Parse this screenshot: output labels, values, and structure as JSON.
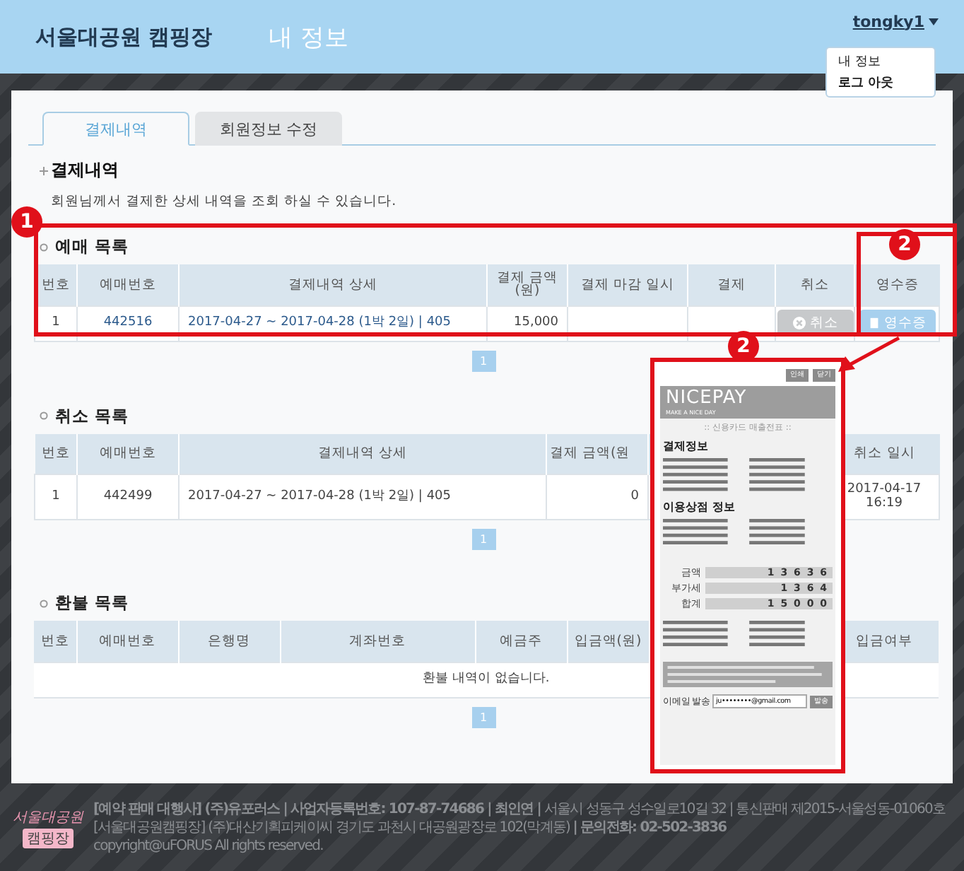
{
  "header": {
    "site_title": "서울대공원 캠핑장",
    "page_title": "내 정보",
    "user": "tongky1",
    "user_menu": [
      {
        "label": "내 정보",
        "selected": false
      },
      {
        "label": "로그 아웃",
        "selected": true
      }
    ]
  },
  "tabs": [
    {
      "label": "결제내역",
      "selected": true
    },
    {
      "label": "회원정보 수정",
      "selected": false
    }
  ],
  "section": {
    "title": "결제내역",
    "description": "회원님께서 결제한 상세 내역을 조회 하실 수 있습니다."
  },
  "bookings": {
    "title": "예매 목록",
    "columns": [
      "번호",
      "예매번호",
      "결제내역 상세",
      "결제 금액\n(원)",
      "결제 마감 일시",
      "결제",
      "취소",
      "영수증"
    ],
    "rows": [
      {
        "no": "1",
        "booking_no": "442516",
        "detail": "2017-04-27 ~ 2017-04-28 (1박 2일) | 405",
        "amount": "15,000",
        "deadline": "",
        "payment": "",
        "cancel_button": {
          "label": "취소",
          "disabled": true
        },
        "receipt_button": {
          "label": "영수증",
          "disabled": false
        }
      }
    ],
    "pagination": [
      {
        "label": "1",
        "selected": true
      }
    ]
  },
  "cancellations": {
    "title": "취소 목록",
    "columns": [
      "번호",
      "예매번호",
      "결제내역 상세",
      "결제 금액(원",
      "취소 일시"
    ],
    "rows": [
      {
        "cells": [
          "1",
          "442499",
          "2017-04-27 ~ 2017-04-28 (1박 2일) | 405",
          "0",
          "2017-04-17\n16:19"
        ]
      }
    ],
    "pagination": [
      {
        "label": "1",
        "selected": true
      }
    ]
  },
  "refunds": {
    "title": "환불 목록",
    "columns": [
      "번호",
      "예매번호",
      "은행명",
      "계좌번호",
      "예금주",
      "입금액(원)",
      "입금여부"
    ],
    "empty_message": "환불 내역이 없습니다.",
    "pagination": [
      {
        "label": "1",
        "selected": true
      }
    ]
  },
  "receipt_popup": {
    "buttons": [
      "인쇄",
      "닫기"
    ],
    "brand": "NICEPAY",
    "slogan": "MAKE A NICE DAY",
    "title": ":: 신용카드 매출전표 ::",
    "payment_heading": "결제정보",
    "merchant_heading": "이용상점 정보",
    "amounts": [
      {
        "label": "금액",
        "value": "1 3 6 3 6"
      },
      {
        "label": "부가세",
        "value": "1 3 6 4"
      },
      {
        "label": "합계",
        "value": "1 5 0 0 0"
      }
    ],
    "email_label": "이메일 발송",
    "email": "ju••••••••@gmail.com",
    "send_button": "발송"
  },
  "annotations": [
    {
      "label": "1"
    },
    {
      "label": "2"
    },
    {
      "label": "2"
    }
  ],
  "footer": {
    "logo": [
      "서울대공원",
      "캠핑장"
    ],
    "lines": [
      "**[예약 판매 대행사] (주)유포러스 | 사업자등록번호: 107-87-74686 | 최인연 |** 서울시 성동구 성수일로10길 32 | 통신판매 제2015-서울성동-01060호",
      "[서울대공원캠핑장] (주)대산기획피케이씨 경기도 과천시 대공원광장로 102(막계동) **| 문의전화: 02-502-3836**",
      "copyright@uFORUS All rights reserved."
    ]
  }
}
